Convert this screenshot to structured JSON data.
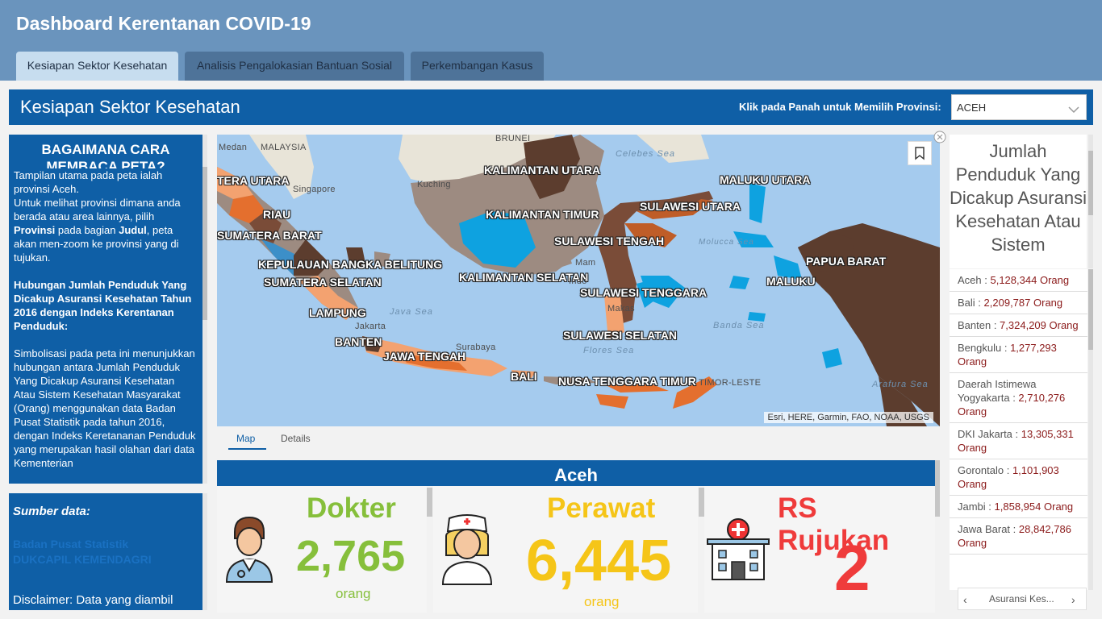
{
  "app": {
    "title": "Dashboard Kerentanan COVID-19"
  },
  "tabs": [
    {
      "label": "Kesiapan Sektor Kesehatan",
      "active": true
    },
    {
      "label": "Analisis Pengalokasian Bantuan Sosial",
      "active": false
    },
    {
      "label": "Perkembangan Kasus",
      "active": false
    }
  ],
  "section": {
    "title": "Kesiapan Sektor Kesehatan",
    "province_label": "Klik pada Panah untuk Memilih Provinsi:",
    "province_value": "ACEH"
  },
  "guide": {
    "heading": "BAGAIMANA CARA MEMBACA PETA?",
    "p1": "Tampilan utama pada peta ialah provinsi Aceh.",
    "p2_a": "Untuk melihat provinsi dimana anda berada atau area lainnya, pilih ",
    "p2_b": "Provinsi",
    "p2_c": " pada bagian ",
    "p2_d": "Judul",
    "p2_e": ", peta akan men-zoom ke provinsi yang di tujukan.",
    "subheading": "Hubungan Jumlah Penduduk Yang Dicakup Asuransi Kesehatan Tahun 2016 dengan Indeks Kerentanan Penduduk:",
    "p3": "Simbolisasi pada peta ini menunjukkan hubungan antara Jumlah Penduduk Yang Dicakup Asuransi Kesehatan Atau Sistem Kesehatan Masyarakat (Orang) menggunakan data Badan Pusat Statistik pada tahun 2016, dengan Indeks Keretananan Penduduk yang merupakan hasil olahan dari data Kementerian"
  },
  "sources": {
    "title": "Sumber data:",
    "items": [
      "Badan Pusat Statistik",
      "DUKCAPIL KEMENDAGRI"
    ],
    "disclaimer": "Disclaimer: Data yang diambil"
  },
  "map": {
    "province_labels": [
      "KALIMANTAN UTARA",
      "MALUKU UTARA",
      "TERA UTARA",
      "RIAU",
      "SULAWESI UTARA",
      "KALIMANTAN TIMUR",
      "SUMATERA BARAT",
      "SULAWESI TENGAH",
      "KEPULAUAN BANGKA BELITUNG",
      "PAPUA BARAT",
      "KALIMANTAN SELATAN",
      "SUMATERA SELATAN",
      "MALUKU",
      "SULAWESI TENGGARA",
      "LAMPUNG",
      "SULAWESI SELATAN",
      "BANTEN",
      "JAWA TENGAH",
      "BALI",
      "NUSA TENGGARA TIMUR"
    ],
    "basemap_labels": [
      "Medan",
      "MALAYSIA",
      "BRUNEI",
      "Kuching",
      "Singapore",
      "Mam",
      "Indo",
      "Makas",
      "Jakarta",
      "Surabaya",
      "TIMOR-LESTE"
    ],
    "sea_labels": [
      "Celebes Sea",
      "Molucca Sea",
      "Java Sea",
      "Banda Sea",
      "Flores Sea",
      "Arafura Sea"
    ],
    "attribution": "Esri, HERE, Garmin, FAO, NOAA, USGS",
    "bookmark_icon": "bookmark-icon",
    "view_tabs": [
      "Map",
      "Details"
    ]
  },
  "stats": {
    "province": "Aceh",
    "doctor": {
      "label": "Dokter",
      "value": "2,765",
      "unit": "orang",
      "color": "#86bf3b"
    },
    "nurse": {
      "label": "Perawat",
      "value": "6,445",
      "unit": "orang",
      "color": "#f5c518"
    },
    "hospital": {
      "label": "RS Rujukan",
      "value": "2",
      "color": "#ef3b3b"
    }
  },
  "right_panel": {
    "title": "Jumlah Penduduk Yang Dicakup Asuransi Kesehatan Atau Sistem",
    "items": [
      {
        "name": "Aceh",
        "value": "5,128,344",
        "unit": "Orang"
      },
      {
        "name": "Bali",
        "value": "2,209,787",
        "unit": "Orang"
      },
      {
        "name": "Banten",
        "value": "7,324,209",
        "unit": "Orang"
      },
      {
        "name": "Bengkulu",
        "value": "1,277,293",
        "unit": "Orang"
      },
      {
        "name": "Daerah Istimewa Yogyakarta",
        "value": "2,710,276",
        "unit": "Orang"
      },
      {
        "name": "DKI Jakarta",
        "value": "13,305,331",
        "unit": "Orang"
      },
      {
        "name": "Gorontalo",
        "value": "1,101,903",
        "unit": "Orang"
      },
      {
        "name": "Jambi",
        "value": "1,858,954",
        "unit": "Orang"
      },
      {
        "name": "Jawa Barat",
        "value": "28,842,786",
        "unit": "Orang"
      }
    ],
    "pager_label": "Asuransi Kes..."
  }
}
